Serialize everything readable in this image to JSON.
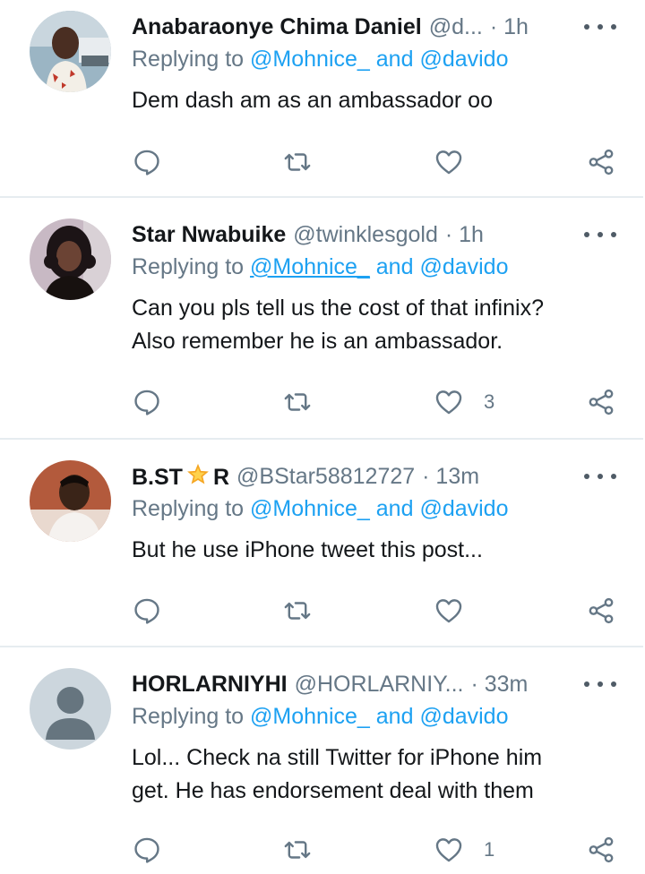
{
  "colors": {
    "link": "#1da1f2",
    "muted": "#657786",
    "text": "#14171a",
    "divider": "#e6ecf0"
  },
  "tweets": [
    {
      "name": "Anabaraonye Chima Daniel",
      "handle": "@d...",
      "time": "· 1h",
      "reply_prefix": "Replying to",
      "mention1": "@Mohnice_",
      "reply_and": "and",
      "mention2": "@davido",
      "body": [
        "Dem dash am as an ambassador oo"
      ],
      "like_count": ""
    },
    {
      "name": "Star Nwabuike",
      "handle": "@twinklesgold",
      "time": "· 1h",
      "reply_prefix": "Replying to",
      "mention1": "@Mohnice_",
      "reply_and": "and",
      "mention2": "@davido",
      "body": [
        "Can you pls tell us the cost of that infinix?",
        "Also remember he is an ambassador."
      ],
      "like_count": "3"
    },
    {
      "name_part1": "B.ST",
      "name_part2": "R",
      "handle": "@BStar58812727",
      "time": "· 13m",
      "reply_prefix": "Replying to",
      "mention1": "@Mohnice_",
      "reply_and": "and",
      "mention2": "@davido",
      "body": [
        "But he use iPhone tweet this post..."
      ],
      "like_count": ""
    },
    {
      "name": "HORLARNIYHI",
      "handle": "@HORLARNIY...",
      "time": "· 33m",
      "reply_prefix": "Replying to",
      "mention1": "@Mohnice_",
      "reply_and": "and",
      "mention2": "@davido",
      "body": [
        "Lol...  Check na still Twitter for iPhone him",
        "get. He has endorsement deal with them"
      ],
      "like_count": "1"
    }
  ],
  "icons": {
    "reply": "reply-icon",
    "retweet": "retweet-icon",
    "like": "heart-icon",
    "share": "share-icon",
    "more": "more-options-icon",
    "star_emoji": "star-emoji-icon",
    "default_avatar": "default-avatar-icon"
  }
}
